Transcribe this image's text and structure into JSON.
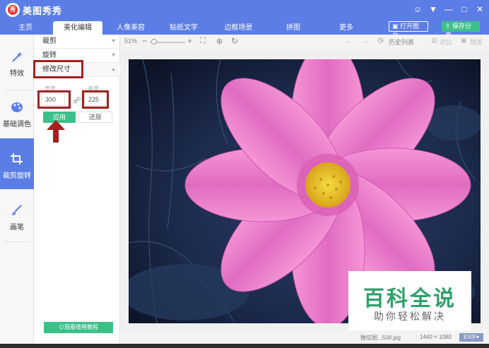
{
  "app": {
    "title": "美图秀秀",
    "logo_char": "秀"
  },
  "window_controls": {
    "chat": "☺",
    "menu": "▼",
    "minimize": "—",
    "maximize": "□",
    "close": "✕"
  },
  "tabs": [
    {
      "label": "主页"
    },
    {
      "label": "美化编辑"
    },
    {
      "label": "人像美容"
    },
    {
      "label": "贴纸文字"
    },
    {
      "label": "边框场景"
    },
    {
      "label": "拼图"
    },
    {
      "label": "更多"
    }
  ],
  "header_buttons": {
    "open": "打开图片",
    "save": "保存分享"
  },
  "sidenav": [
    {
      "label": "特效"
    },
    {
      "label": "基础调色"
    },
    {
      "label": "裁剪旋转"
    },
    {
      "label": "画笔"
    }
  ],
  "panel": {
    "crop": "裁剪",
    "rotate": "旋转",
    "resize": "修改尺寸",
    "width_label": "宽度",
    "height_label": "高度",
    "width_value": "300",
    "height_value": "225",
    "apply": "应用",
    "reset": "还原",
    "tutorial": "观看使用教程"
  },
  "canvas_toolbar": {
    "zoom": "51%",
    "history": "历史列表",
    "compare": "对比",
    "preview": "预览"
  },
  "status": {
    "filename": "微信图...508.jpg",
    "dimensions": "1440 × 1080",
    "exif": "EXIF"
  },
  "watermark": {
    "title": "百科全说",
    "subtitle": "助你轻松解决"
  },
  "colors": {
    "brand": "#5b7de6",
    "accent": "#3cc08a",
    "annotation": "#a51f1f"
  }
}
